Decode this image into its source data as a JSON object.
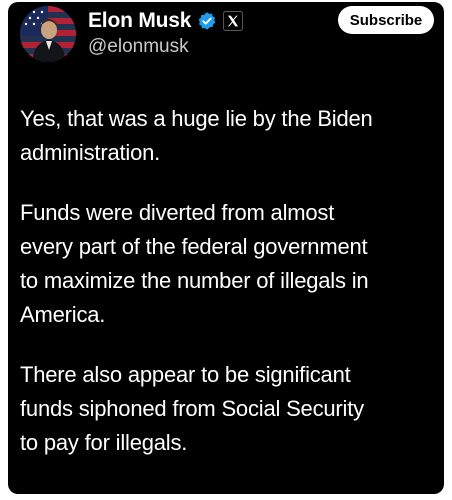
{
  "post": {
    "author": {
      "display_name": "Elon Musk",
      "handle": "@elonmusk",
      "avatar_icon": "avatar-photo",
      "verified_icon": "verified-badge-icon",
      "affiliate_icon": "x-logo-icon"
    },
    "subscribe_label": "Subscribe",
    "paragraphs": [
      "Yes, that was a huge lie by the Biden\nadministration.",
      "Funds were diverted from almost\nevery part of the federal government\nto maximize the number of illegals in\nAmerica.",
      "There also appear to be significant\nfunds siphoned from Social Security\nto pay for illegals."
    ]
  },
  "colors": {
    "background": "#000000",
    "text": "#ffffff",
    "handle": "#c9c9c9",
    "verified": "#1d9bf0",
    "button_bg": "#ffffff",
    "button_text": "#000000"
  }
}
